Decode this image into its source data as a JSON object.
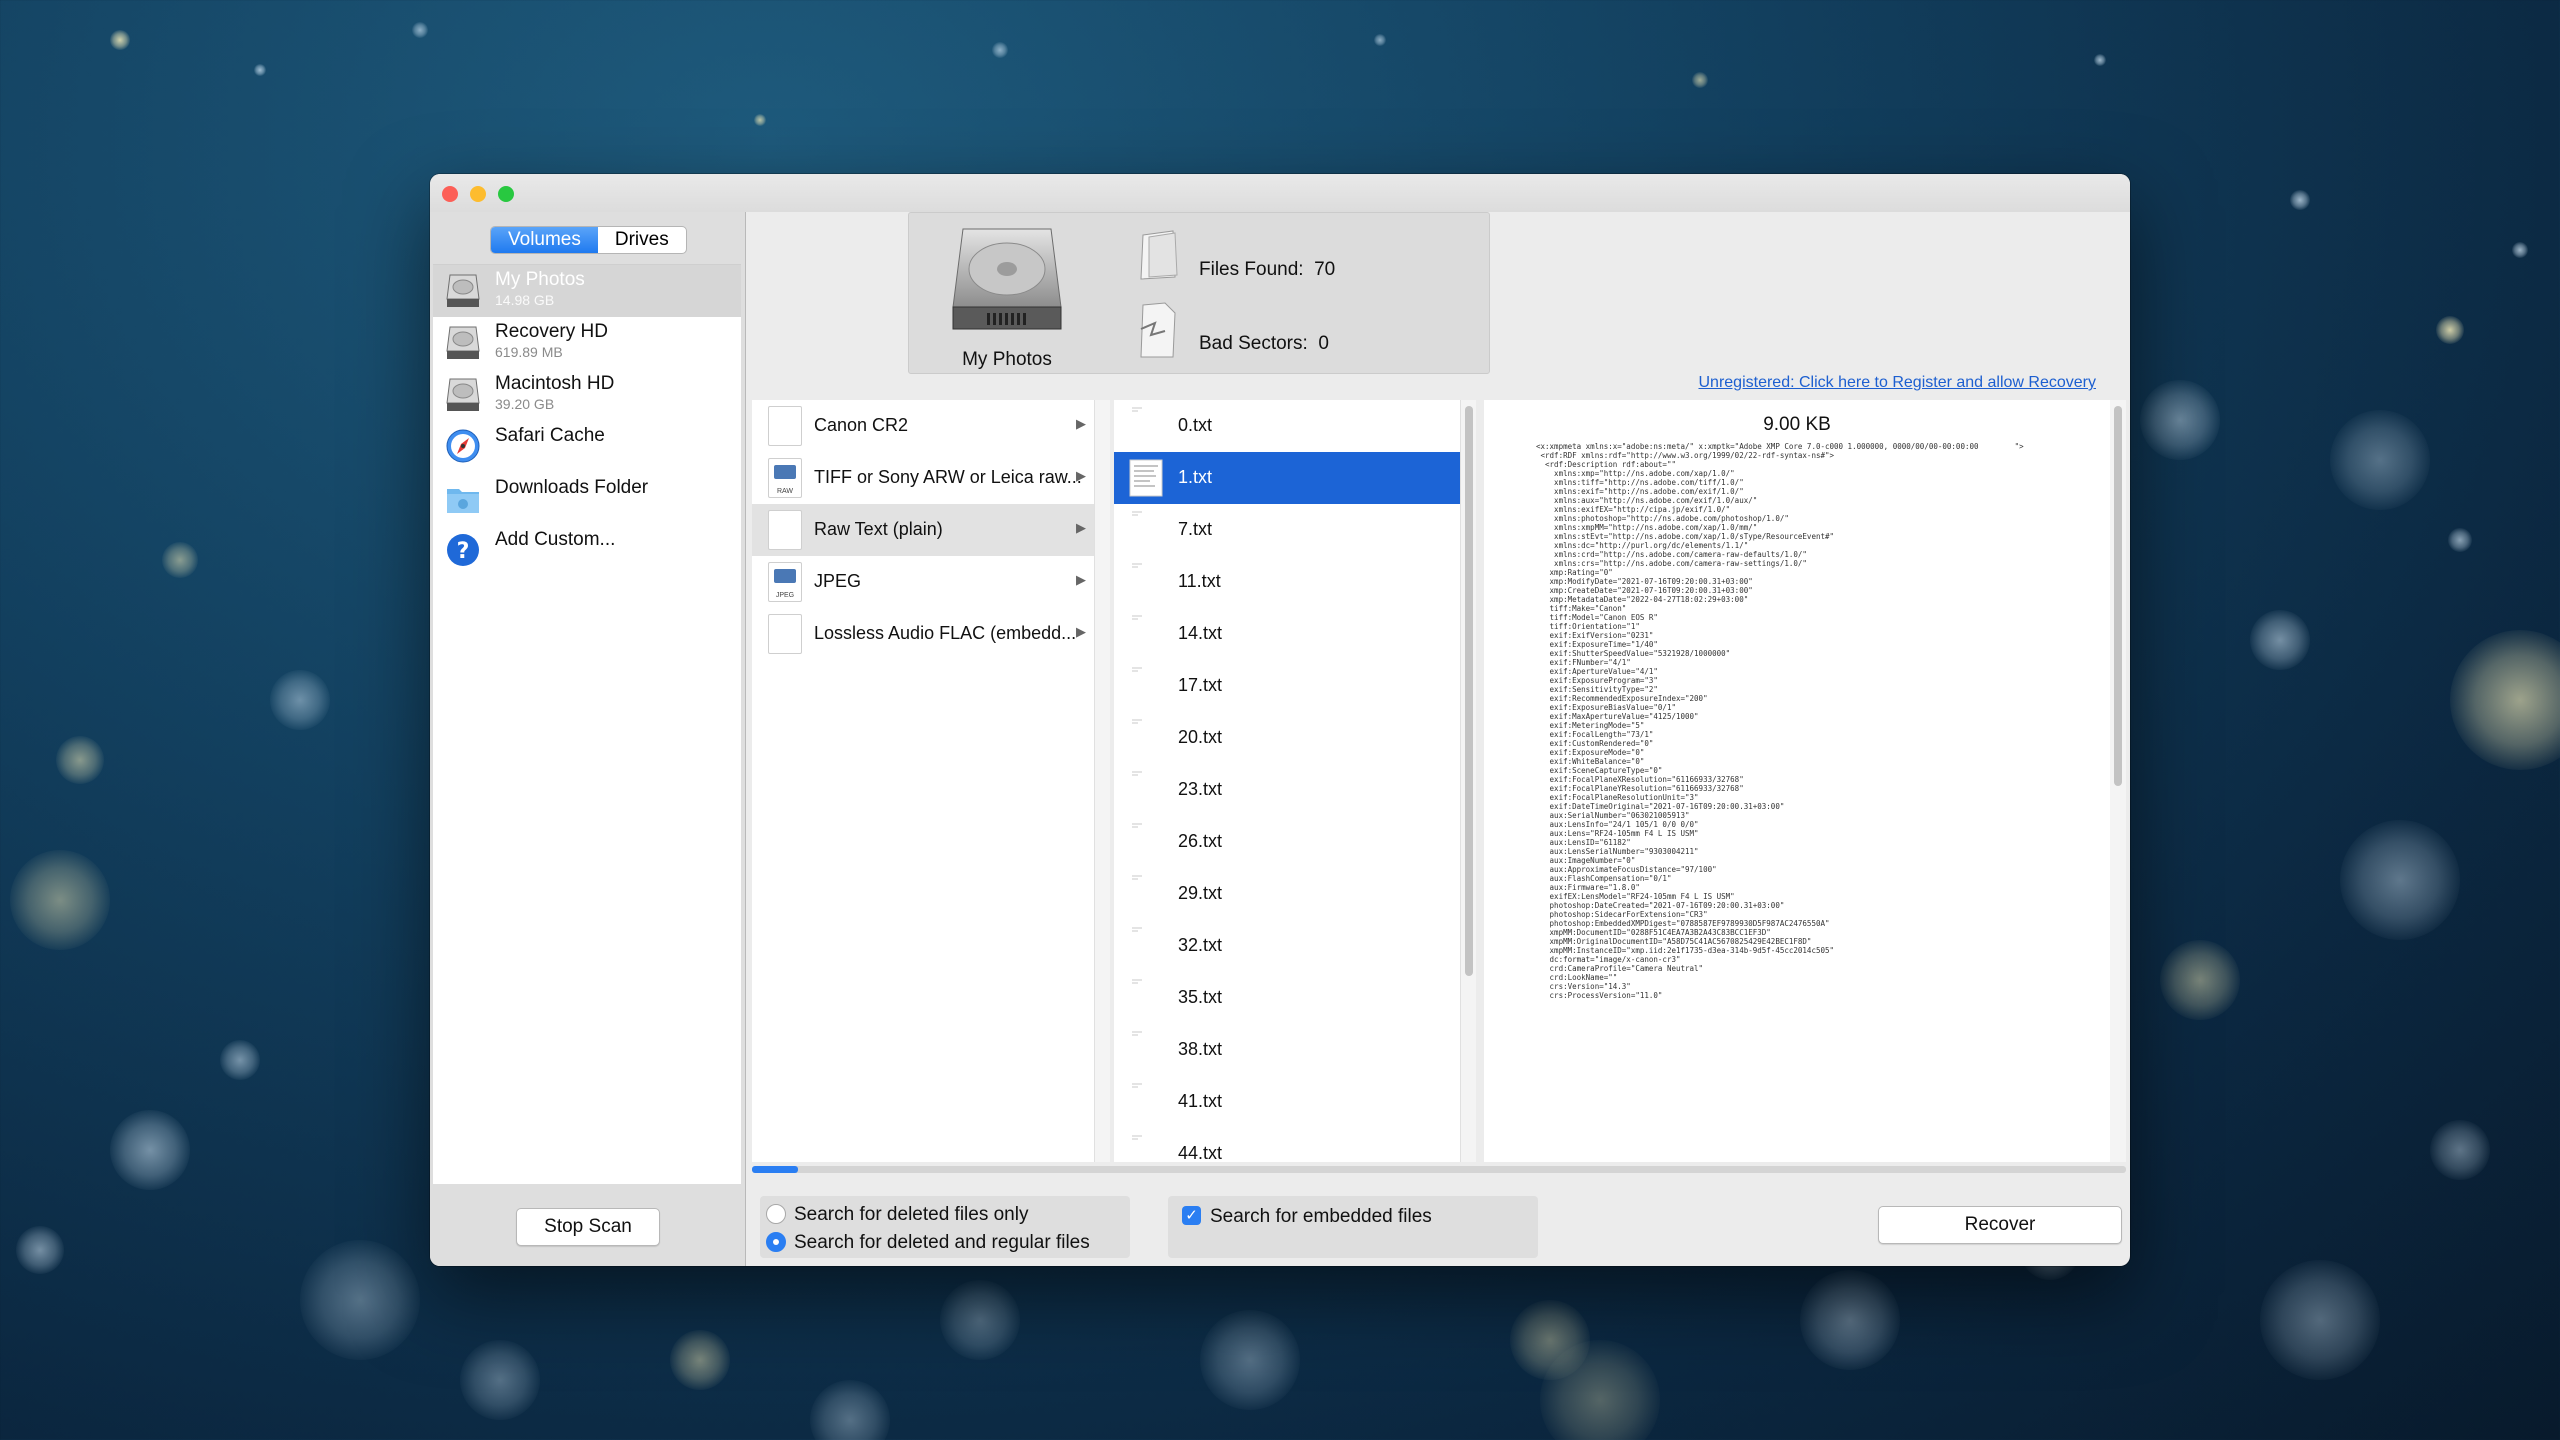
{
  "window": {
    "traffic_lights": {
      "close": "#fc5f57",
      "minimize": "#fdbc2e",
      "zoom": "#28c840"
    }
  },
  "sidebar": {
    "tabs": [
      {
        "label": "Volumes",
        "active": true
      },
      {
        "label": "Drives",
        "active": false
      }
    ],
    "items": [
      {
        "name": "My Photos",
        "size": "14.98 GB",
        "icon": "hard-drive-icon",
        "selected": true
      },
      {
        "name": "Recovery HD",
        "size": "619.89 MB",
        "icon": "hard-drive-icon"
      },
      {
        "name": "Macintosh HD",
        "size": "39.20 GB",
        "icon": "hard-drive-icon"
      },
      {
        "name": "Safari Cache",
        "size": "",
        "icon": "compass-icon"
      },
      {
        "name": "Downloads Folder",
        "size": "",
        "icon": "folder-icon"
      },
      {
        "name": "Add Custom...",
        "size": "",
        "icon": "question-icon"
      }
    ],
    "stop_scan": "Stop Scan"
  },
  "header": {
    "drive_name": "My Photos",
    "files_found_label": "Files Found:",
    "files_found_value": "70",
    "bad_sectors_label": "Bad Sectors:",
    "bad_sectors_value": "0"
  },
  "register_link": "Unregistered: Click here to Register and allow Recovery",
  "file_types": [
    {
      "name": "Canon CR2",
      "badge": ""
    },
    {
      "name": "TIFF or Sony ARW or Leica raw...",
      "badge": "RAW"
    },
    {
      "name": "Raw Text (plain)",
      "badge": "",
      "selected": true
    },
    {
      "name": "JPEG",
      "badge": "JPEG"
    },
    {
      "name": "Lossless Audio FLAC (embedd...",
      "badge": ""
    }
  ],
  "files": [
    {
      "name": "0.txt"
    },
    {
      "name": "1.txt",
      "selected": true
    },
    {
      "name": "7.txt"
    },
    {
      "name": "11.txt"
    },
    {
      "name": "14.txt"
    },
    {
      "name": "17.txt"
    },
    {
      "name": "20.txt"
    },
    {
      "name": "23.txt"
    },
    {
      "name": "26.txt"
    },
    {
      "name": "29.txt"
    },
    {
      "name": "32.txt"
    },
    {
      "name": "35.txt"
    },
    {
      "name": "38.txt"
    },
    {
      "name": "41.txt"
    },
    {
      "name": "44.txt"
    }
  ],
  "preview": {
    "size": "9.00 KB",
    "text": "<x:xmpmeta xmlns:x=\"adobe:ns:meta/\" x:xmptk=\"Adobe XMP Core 7.0-c000 1.000000, 0000/00/00-00:00:00        \">\n <rdf:RDF xmlns:rdf=\"http://www.w3.org/1999/02/22-rdf-syntax-ns#\">\n  <rdf:Description rdf:about=\"\"\n    xmlns:xmp=\"http://ns.adobe.com/xap/1.0/\"\n    xmlns:tiff=\"http://ns.adobe.com/tiff/1.0/\"\n    xmlns:exif=\"http://ns.adobe.com/exif/1.0/\"\n    xmlns:aux=\"http://ns.adobe.com/exif/1.0/aux/\"\n    xmlns:exifEX=\"http://cipa.jp/exif/1.0/\"\n    xmlns:photoshop=\"http://ns.adobe.com/photoshop/1.0/\"\n    xmlns:xmpMM=\"http://ns.adobe.com/xap/1.0/mm/\"\n    xmlns:stEvt=\"http://ns.adobe.com/xap/1.0/sType/ResourceEvent#\"\n    xmlns:dc=\"http://purl.org/dc/elements/1.1/\"\n    xmlns:crd=\"http://ns.adobe.com/camera-raw-defaults/1.0/\"\n    xmlns:crs=\"http://ns.adobe.com/camera-raw-settings/1.0/\"\n   xmp:Rating=\"0\"\n   xmp:ModifyDate=\"2021-07-16T09:20:00.31+03:00\"\n   xmp:CreateDate=\"2021-07-16T09:20:00.31+03:00\"\n   xmp:MetadataDate=\"2022-04-27T18:02:29+03:00\"\n   tiff:Make=\"Canon\"\n   tiff:Model=\"Canon EOS R\"\n   tiff:Orientation=\"1\"\n   exif:ExifVersion=\"0231\"\n   exif:ExposureTime=\"1/40\"\n   exif:ShutterSpeedValue=\"5321928/1000000\"\n   exif:FNumber=\"4/1\"\n   exif:ApertureValue=\"4/1\"\n   exif:ExposureProgram=\"3\"\n   exif:SensitivityType=\"2\"\n   exif:RecommendedExposureIndex=\"200\"\n   exif:ExposureBiasValue=\"0/1\"\n   exif:MaxApertureValue=\"4125/1000\"\n   exif:MeteringMode=\"5\"\n   exif:FocalLength=\"73/1\"\n   exif:CustomRendered=\"0\"\n   exif:ExposureMode=\"0\"\n   exif:WhiteBalance=\"0\"\n   exif:SceneCaptureType=\"0\"\n   exif:FocalPlaneXResolution=\"61166933/32768\"\n   exif:FocalPlaneYResolution=\"61166933/32768\"\n   exif:FocalPlaneResolutionUnit=\"3\"\n   exif:DateTimeOriginal=\"2021-07-16T09:20:00.31+03:00\"\n   aux:SerialNumber=\"063021005913\"\n   aux:LensInfo=\"24/1 105/1 0/0 0/0\"\n   aux:Lens=\"RF24-105mm F4 L IS USM\"\n   aux:LensID=\"61182\"\n   aux:LensSerialNumber=\"9303004211\"\n   aux:ImageNumber=\"0\"\n   aux:ApproximateFocusDistance=\"97/100\"\n   aux:FlashCompensation=\"0/1\"\n   aux:Firmware=\"1.8.0\"\n   exifEX:LensModel=\"RF24-105mm F4 L IS USM\"\n   photoshop:DateCreated=\"2021-07-16T09:20:00.31+03:00\"\n   photoshop:SidecarForExtension=\"CR3\"\n   photoshop:EmbeddedXMPDigest=\"0788587EF9789930D5F987AC2476550A\"\n   xmpMM:DocumentID=\"0288F51C4EA7A3B2A43C83BCC1EF3D\"\n   xmpMM:OriginalDocumentID=\"A58D75C41AC5670825429E42BEC1F8D\"\n   xmpMM:InstanceID=\"xmp.iid:2e1f1735-d3ea-314b-9d5f-45cc2014c505\"\n   dc:format=\"image/x-canon-cr3\"\n   crd:CameraProfile=\"Camera Neutral\"\n   crd:LookName=\"\"\n   crs:Version=\"14.3\"\n   crs:ProcessVersion=\"11.0\""
  },
  "options": {
    "deleted_only": "Search for deleted files only",
    "deleted_and_regular": "Search for deleted and regular files",
    "embedded": "Search for embedded files",
    "selected_mode": "deleted_and_regular",
    "embedded_checked": true
  },
  "recover_button": "Recover",
  "accent_color": "#1c64d6"
}
